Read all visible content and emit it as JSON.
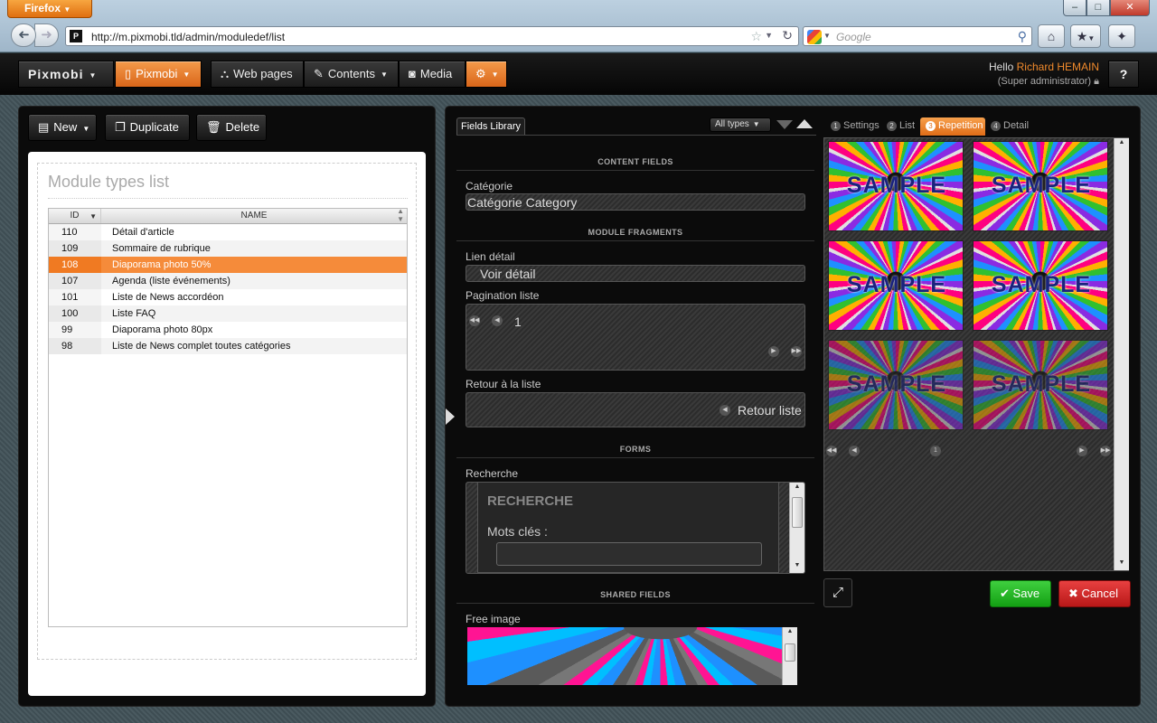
{
  "browser": {
    "menu_label": "Firefox",
    "url": "http://m.pixmobi.tld/admin/moduledef/list",
    "site_icon": "P",
    "search_placeholder": "Google",
    "window_controls": [
      "–",
      "□",
      "✕"
    ]
  },
  "header": {
    "logo": "Pixmobi",
    "site_button": "Pixmobi",
    "nav": [
      {
        "label": "Web pages",
        "icon": "sitemap-icon"
      },
      {
        "label": "Contents",
        "icon": "edit-icon"
      },
      {
        "label": "Media",
        "icon": "camera-icon"
      }
    ],
    "hello_prefix": "Hello",
    "user_name": "Richard HEMAIN",
    "role": "(Super administrator)",
    "help_label": "?"
  },
  "left": {
    "toolbar": {
      "new_label": "New",
      "duplicate_label": "Duplicate",
      "delete_label": "Delete"
    },
    "title": "Module types list",
    "table": {
      "columns": [
        "ID",
        "NAME"
      ],
      "rows": [
        {
          "id": "110",
          "name": "Détail d'article"
        },
        {
          "id": "109",
          "name": "Sommaire de rubrique"
        },
        {
          "id": "108",
          "name": "Diaporama photo 50%",
          "selected": true
        },
        {
          "id": "107",
          "name": "Agenda (liste événements)"
        },
        {
          "id": "101",
          "name": "Liste de News accordéon"
        },
        {
          "id": "100",
          "name": "Liste FAQ"
        },
        {
          "id": "99",
          "name": "Diaporama photo 80px"
        },
        {
          "id": "98",
          "name": "Liste de News complet toutes catégories"
        }
      ]
    }
  },
  "fields": {
    "tab_label": "Fields Library",
    "filter_label": "All types",
    "sections": {
      "content": "CONTENT FIELDS",
      "fragments": "MODULE FRAGMENTS",
      "forms": "FORMS",
      "shared": "SHARED FIELDS"
    },
    "categorie_label": "Catégorie",
    "categorie_value": "Catégorie Category",
    "lien_label": "Lien détail",
    "lien_value": "Voir détail",
    "pagination_label": "Pagination liste",
    "pagination_page": "1",
    "retour_label": "Retour à la liste",
    "retour_value": "Retour liste",
    "recherche_label": "Recherche",
    "recherche_title": "RECHERCHE",
    "recherche_keywords": "Mots clés :",
    "free_image_label": "Free image"
  },
  "preview": {
    "tabs": [
      {
        "num": "1",
        "label": "Settings"
      },
      {
        "num": "2",
        "label": "List"
      },
      {
        "num": "3",
        "label": "Repetition",
        "active": true
      },
      {
        "num": "4",
        "label": "Detail"
      }
    ],
    "thumb_text": "SAMPLE",
    "thumb_count": 6,
    "pager_page": "1",
    "save_label": "Save",
    "cancel_label": "Cancel"
  },
  "colors": {
    "accent": "#f08a2c",
    "save": "#1fb01f",
    "cancel": "#d42a2a",
    "selected_row": "#f58b3a"
  }
}
